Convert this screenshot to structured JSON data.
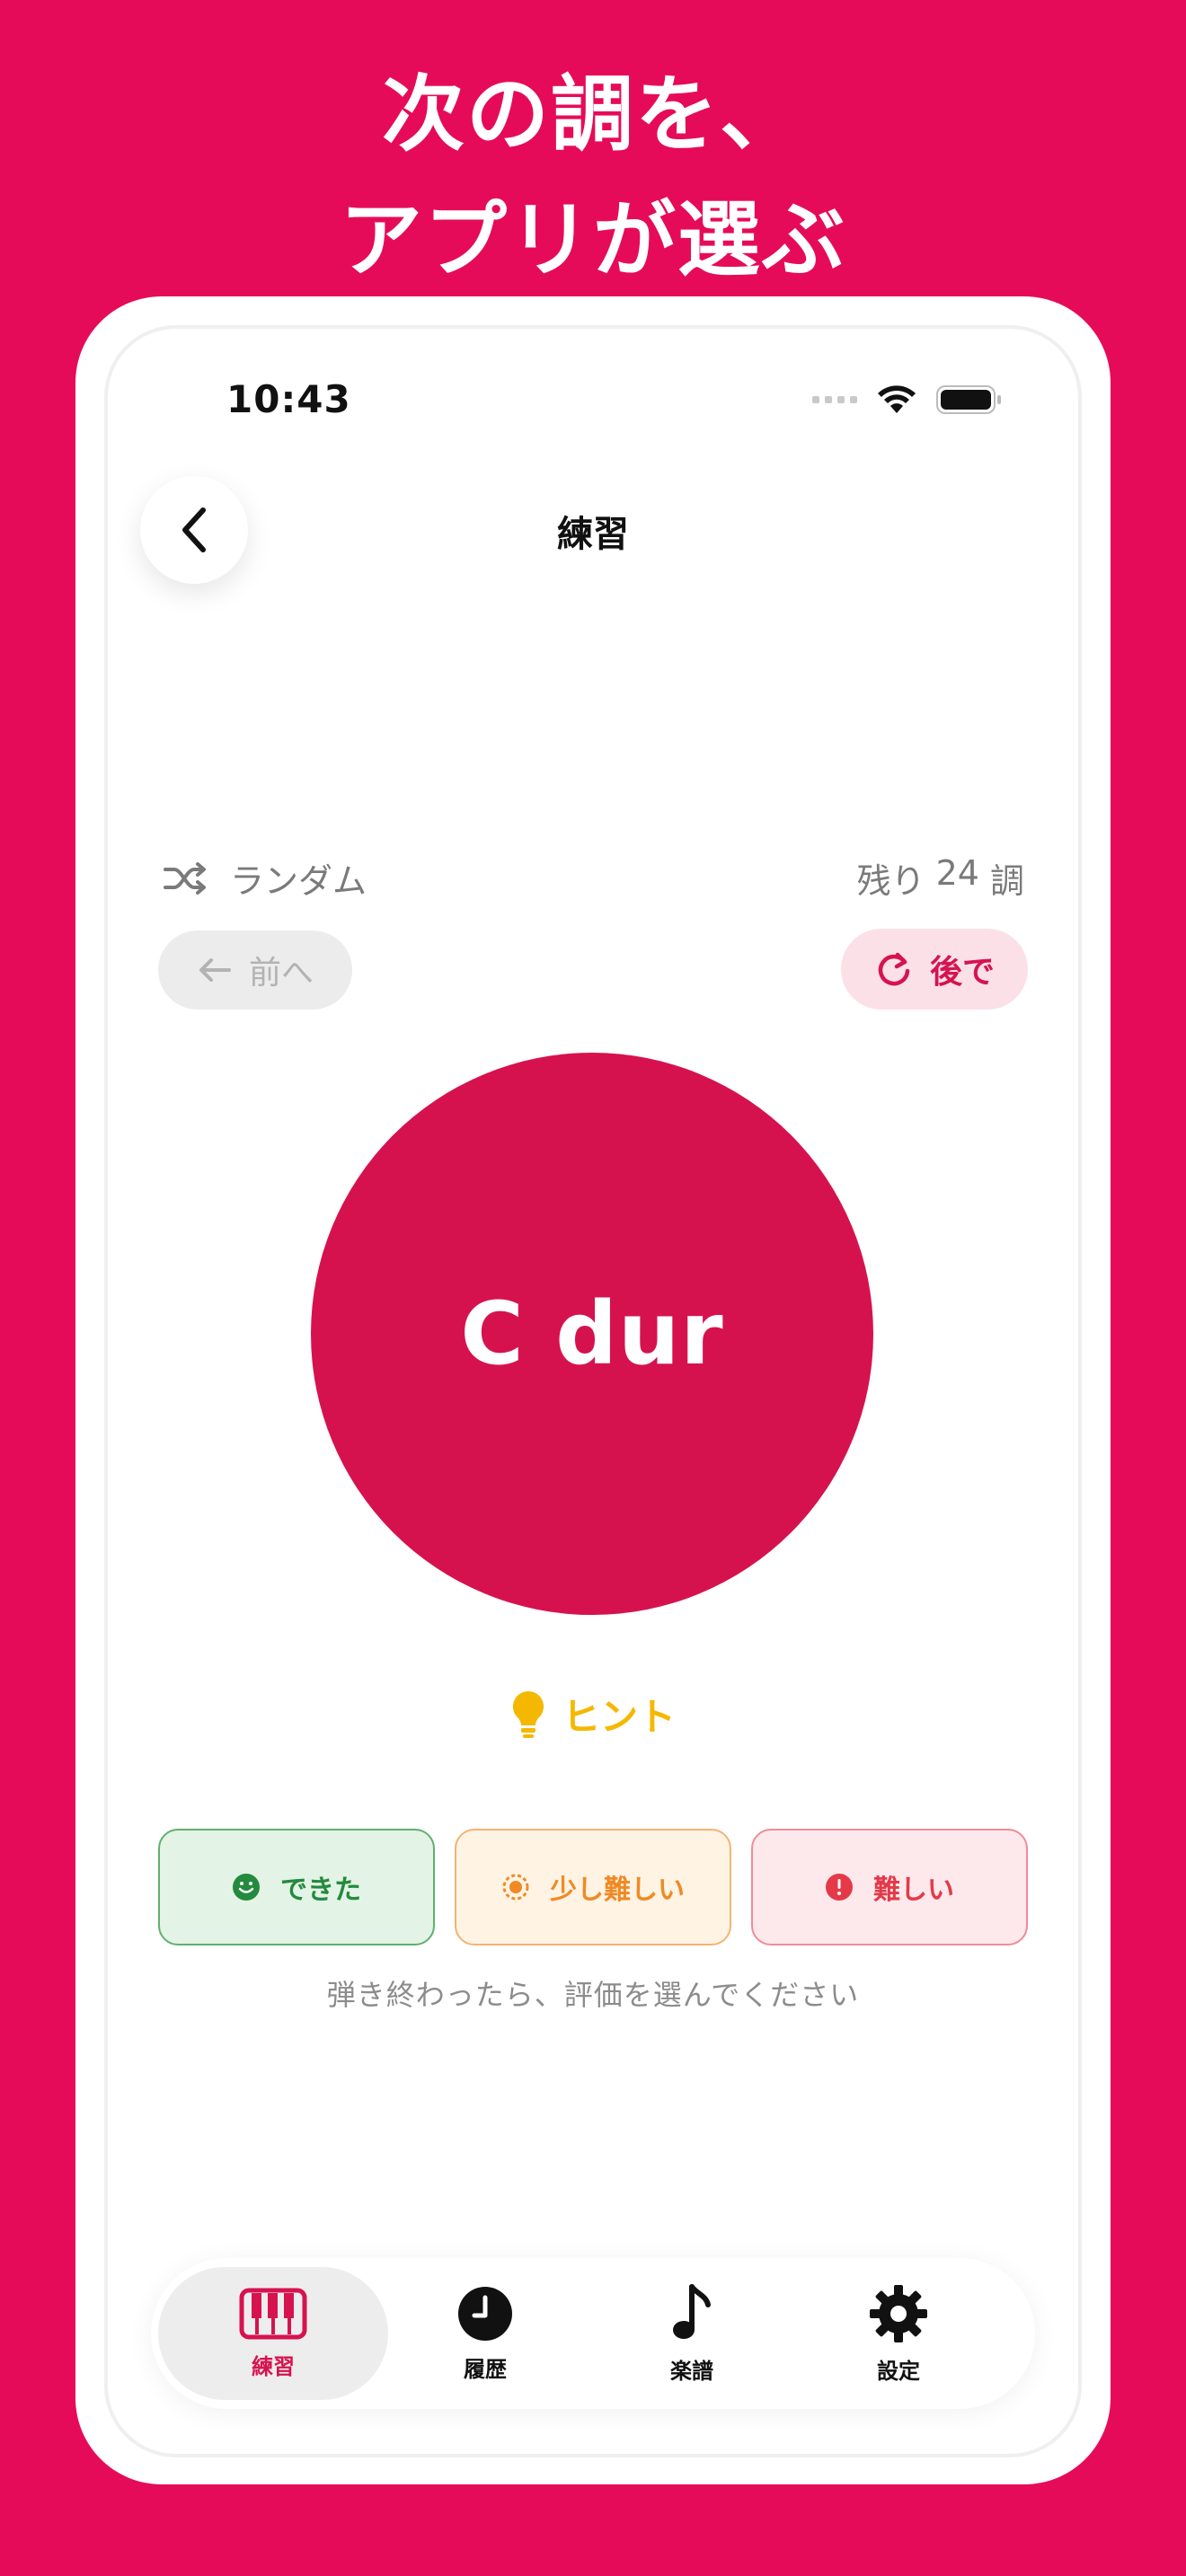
{
  "headline": {
    "line1": "次の調を、",
    "line2": "アプリが選ぶ"
  },
  "status": {
    "time": "10:43"
  },
  "nav": {
    "title": "練習"
  },
  "mode": {
    "label": "ランダム",
    "remaining_prefix": "残り",
    "remaining_count": "24",
    "remaining_suffix": "調"
  },
  "buttons": {
    "prev": "前へ",
    "later": "後で"
  },
  "key": {
    "name": "C dur"
  },
  "hint": {
    "label": "ヒント"
  },
  "rating": {
    "ok": "できた",
    "mid": "少し難しい",
    "hard": "難しい",
    "help": "弾き終わったら、評価を選んでください"
  },
  "tabs": [
    {
      "label": "練習",
      "icon": "piano-icon",
      "active": true
    },
    {
      "label": "履歴",
      "icon": "clock-icon",
      "active": false
    },
    {
      "label": "楽譜",
      "icon": "music-note-icon",
      "active": false
    },
    {
      "label": "設定",
      "icon": "gear-icon",
      "active": false
    }
  ],
  "colors": {
    "brand": "#e60b58",
    "accent": "#d6124e",
    "success": "#248a3d",
    "warning": "#f08a24",
    "danger": "#e53948",
    "hint": "#f5b800"
  }
}
